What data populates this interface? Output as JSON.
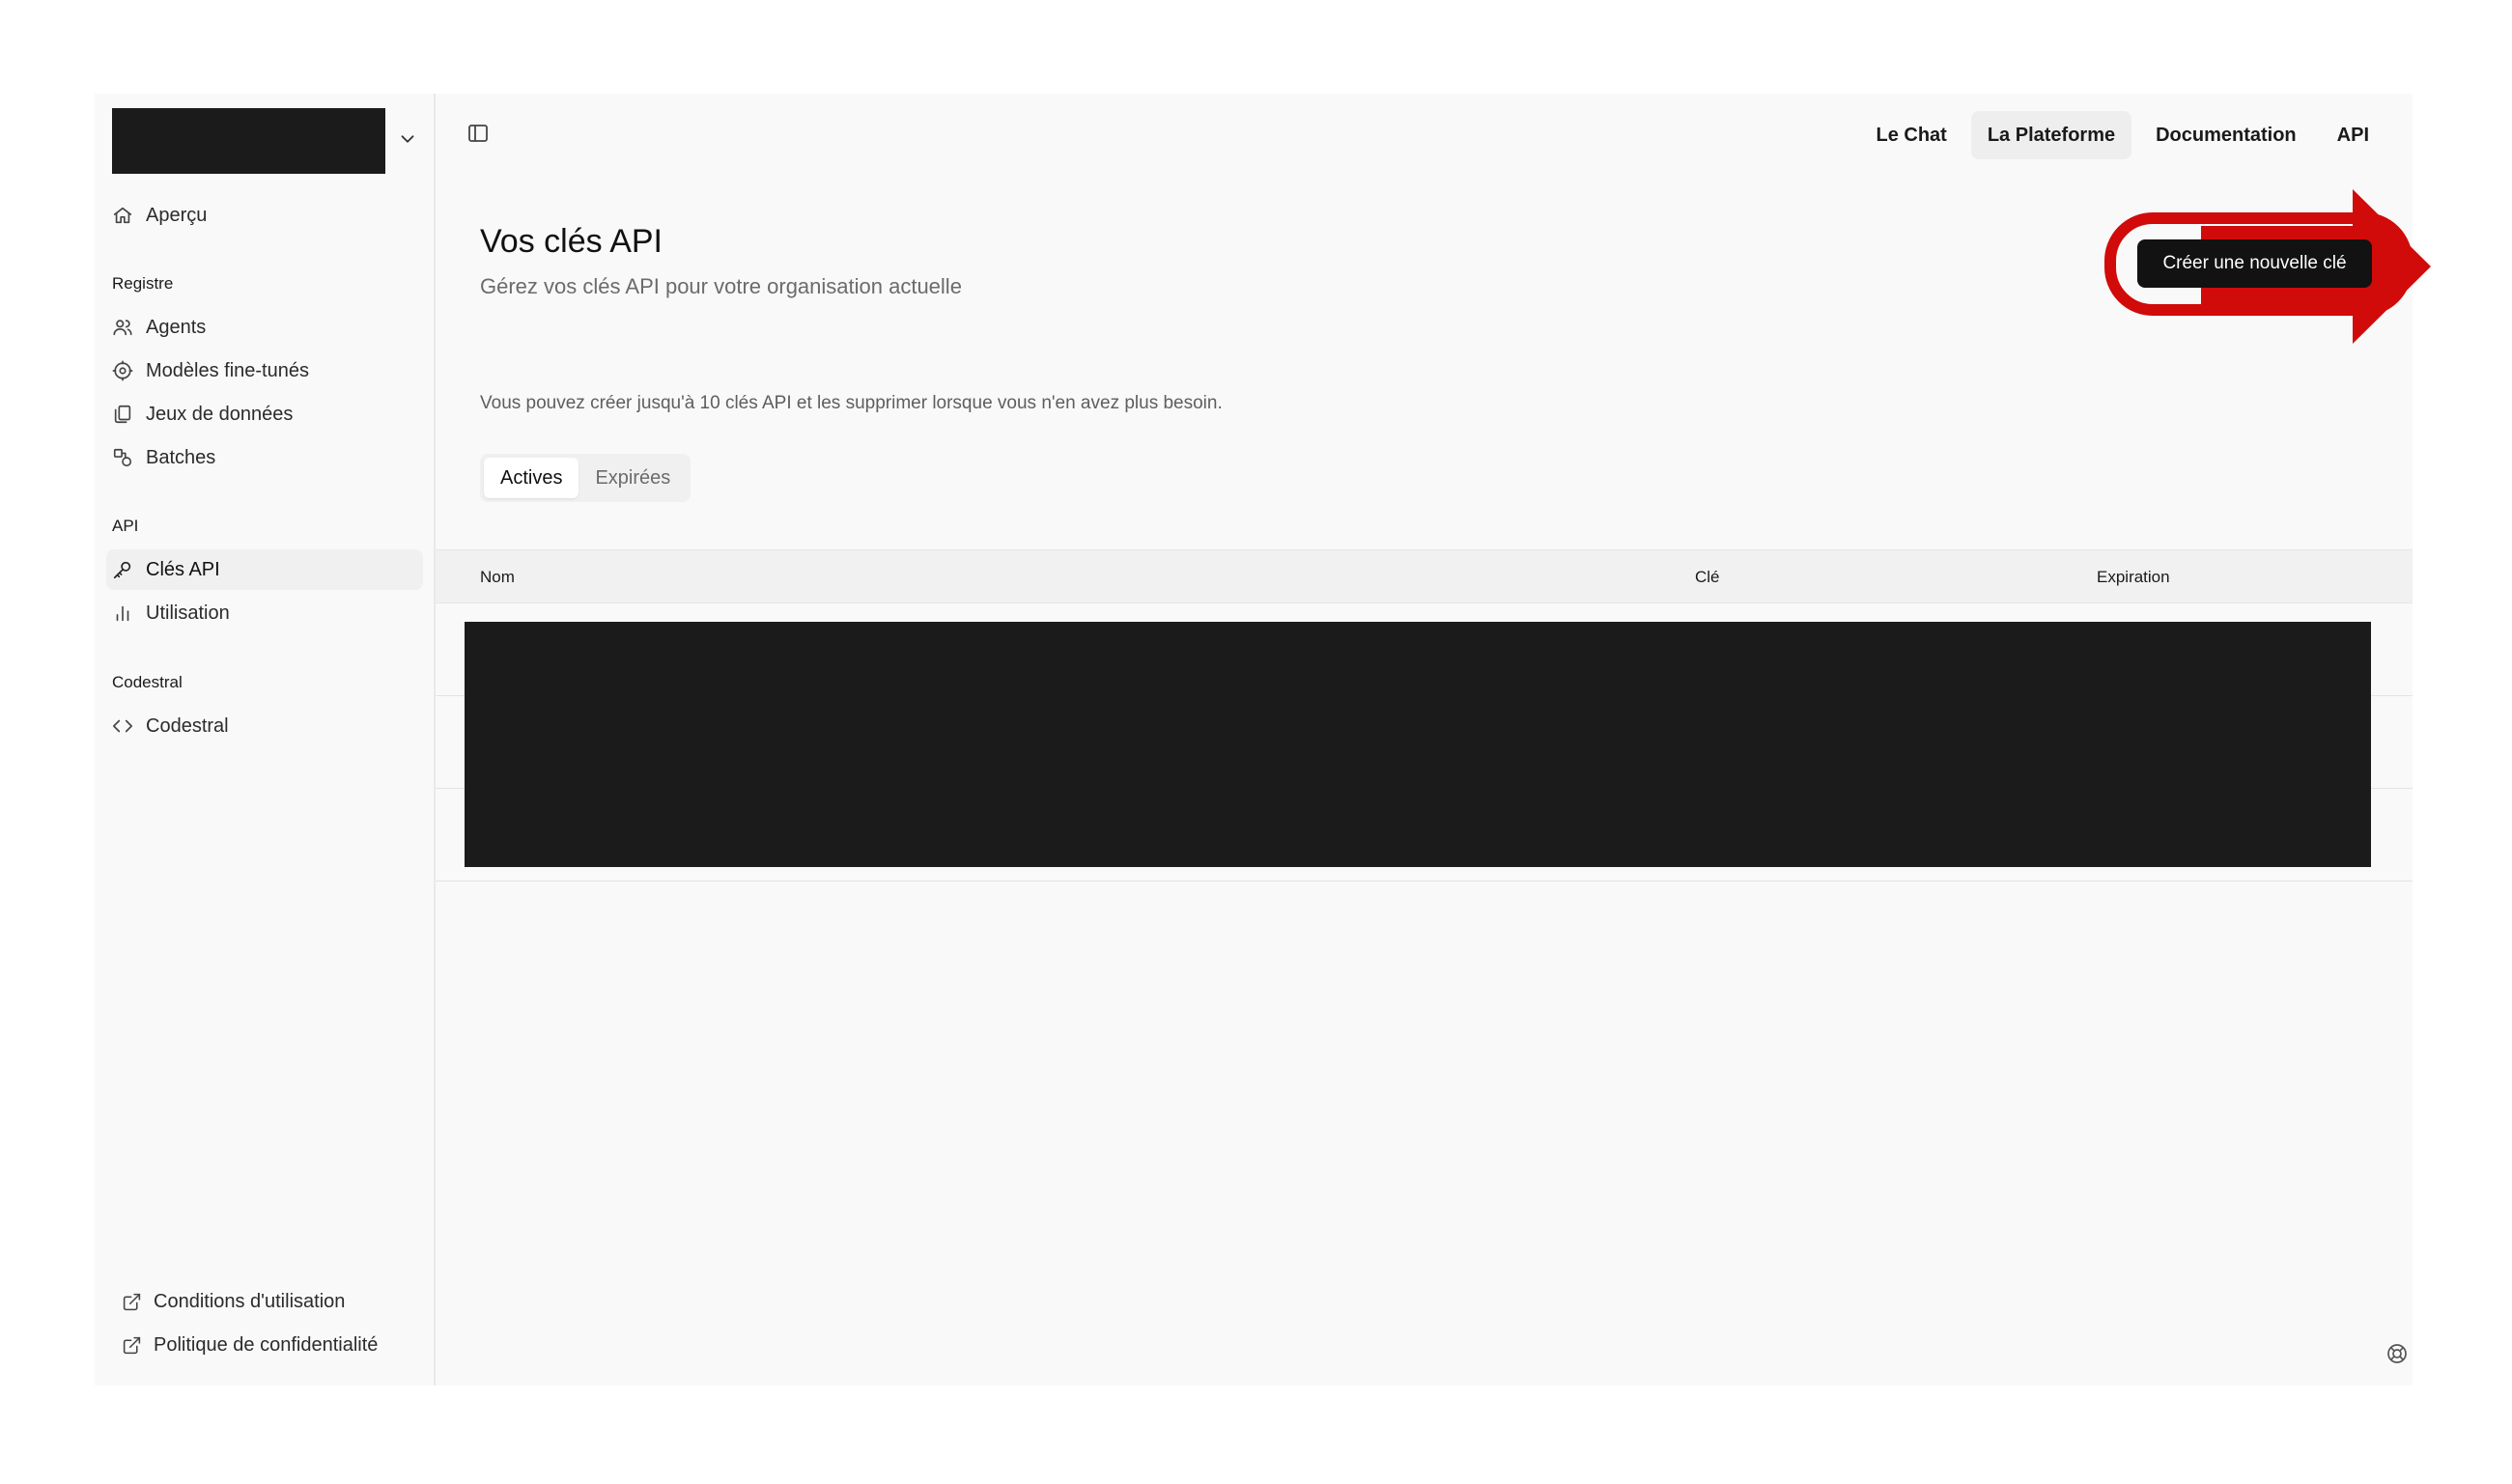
{
  "sidebar": {
    "items": {
      "overview": "Aperçu",
      "agents": "Agents",
      "finetuned": "Modèles fine-tunés",
      "datasets": "Jeux de données",
      "batches": "Batches",
      "apikeys": "Clés API",
      "usage": "Utilisation",
      "codestral": "Codestral"
    },
    "sections": {
      "registry": "Registre",
      "api": "API",
      "codestral": "Codestral"
    },
    "footer": {
      "terms": "Conditions d'utilisation",
      "privacy": "Politique de confidentialité"
    }
  },
  "topnav": {
    "chat": "Le Chat",
    "platform": "La Plateforme",
    "docs": "Documentation",
    "api": "API"
  },
  "page": {
    "title": "Vos clés API",
    "subtitle": "Gérez vos clés API pour votre organisation actuelle",
    "info": "Vous pouvez créer jusqu'à 10 clés API et les supprimer lorsque vous n'en avez plus besoin.",
    "create_button": "Créer une nouvelle clé"
  },
  "tabs": {
    "active": "Actives",
    "expired": "Expirées"
  },
  "table": {
    "columns": {
      "name": "Nom",
      "key": "Clé",
      "expiration": "Expiration"
    }
  },
  "colors": {
    "annotation": "#d10a0a",
    "button_bg": "#121212"
  }
}
